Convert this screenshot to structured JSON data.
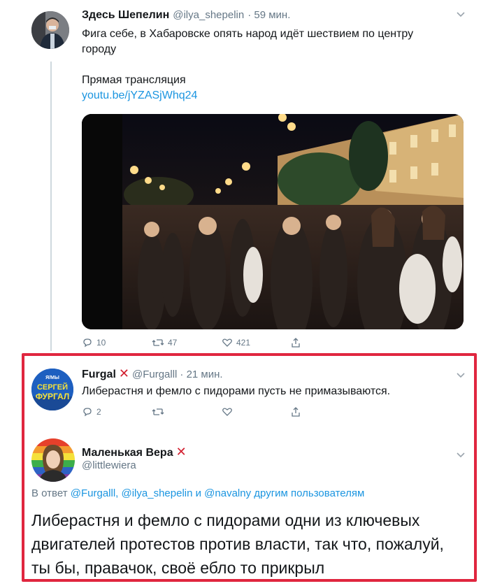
{
  "tweet1": {
    "author": "Здесь Шепелин",
    "handle": "@ilya_shepelin",
    "time": "· 59 мин.",
    "text_line1": "Фига себе, в Хабаровске опять народ идёт шествием по центру",
    "text_line2": "городу",
    "text_line3": "Прямая трансляция",
    "link": "youtu.be/jYZASjWhq24",
    "replies": "10",
    "retweets": "47",
    "likes": "421"
  },
  "tweet2": {
    "author": "Furgal",
    "handle": "@Furgalll",
    "time": "· 21 мин.",
    "text": "Либерастня и фемло с пидорами пусть не примазываются.",
    "replies": "2",
    "avatar_line1": "СЕРГЕЙ",
    "avatar_line2": "ФУРГАЛ",
    "avatar_top": "Я/МЫ"
  },
  "tweet3": {
    "author": "Маленькая Вера",
    "handle": "@littlewiera",
    "reply_prefix": "В ответ",
    "reply_users": "@Furgalll, @ilya_shepelin и @navalny",
    "reply_suffix": "другим пользователям",
    "text_line1": "Либерастня и фемло с пидорами одни из ключевых",
    "text_line2": "двигателей протестов против власти, так что, пожалуй,",
    "text_line3": "ты бы, правачок, своё ебло то прикрыл"
  },
  "colors": {
    "link": "#1b95e0",
    "highlight_border": "#e0263f",
    "x_mark": "#d21f2f"
  },
  "icons": {
    "x_mark": "✕",
    "chevron": "⌄"
  }
}
